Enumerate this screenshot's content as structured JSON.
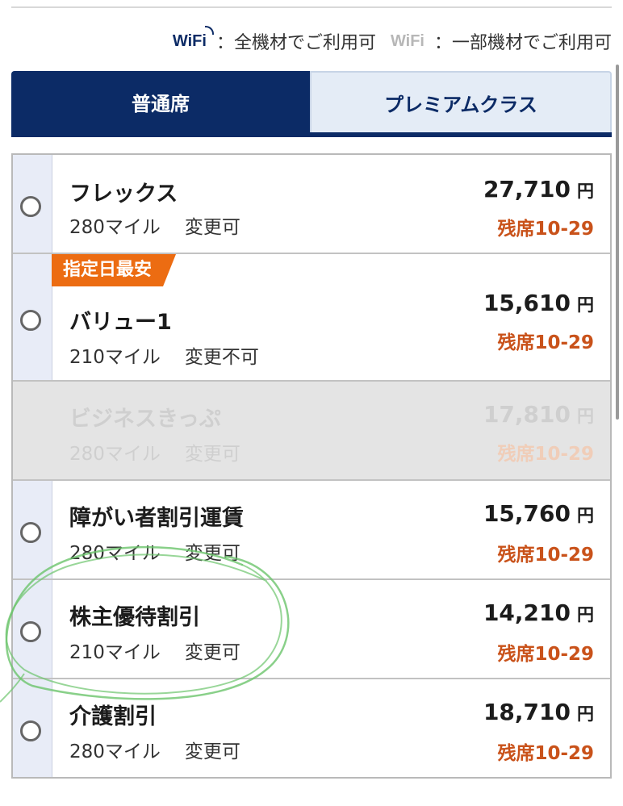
{
  "wifi_legend": {
    "full_logo": "WiFi",
    "full_text": "：全機材でご利用可",
    "partial_logo": "WiFi",
    "partial_text": "：一部機材でご利用可"
  },
  "tabs": [
    {
      "label": "普通席",
      "active": true
    },
    {
      "label": "プレミアムクラス",
      "active": false
    }
  ],
  "currency": "円",
  "fares": [
    {
      "name": "フレックス",
      "miles": "280マイル",
      "change": "変更可",
      "price": "27,710",
      "seats": "残席10-29",
      "badge": "",
      "disabled": false
    },
    {
      "name": "バリュー1",
      "miles": "210マイル",
      "change": "変更不可",
      "price": "15,610",
      "seats": "残席10-29",
      "badge": "指定日最安",
      "disabled": false
    },
    {
      "name": "ビジネスきっぷ",
      "miles": "280マイル",
      "change": "変更可",
      "price": "17,810",
      "seats": "残席10-29",
      "badge": "",
      "disabled": true
    },
    {
      "name": "障がい者割引運賃",
      "miles": "280マイル",
      "change": "変更可",
      "price": "15,760",
      "seats": "残席10-29",
      "badge": "",
      "disabled": false
    },
    {
      "name": "株主優待割引",
      "miles": "210マイル",
      "change": "変更可",
      "price": "14,210",
      "seats": "残席10-29",
      "badge": "",
      "disabled": false
    },
    {
      "name": "介護割引",
      "miles": "280マイル",
      "change": "変更可",
      "price": "18,710",
      "seats": "残席10-29",
      "badge": "",
      "disabled": false
    }
  ],
  "colors": {
    "brand_navy": "#0c2b66",
    "seats_orange": "#c9521a",
    "badge_orange": "#ec6c12",
    "annotation_green": "#6cc46c"
  }
}
